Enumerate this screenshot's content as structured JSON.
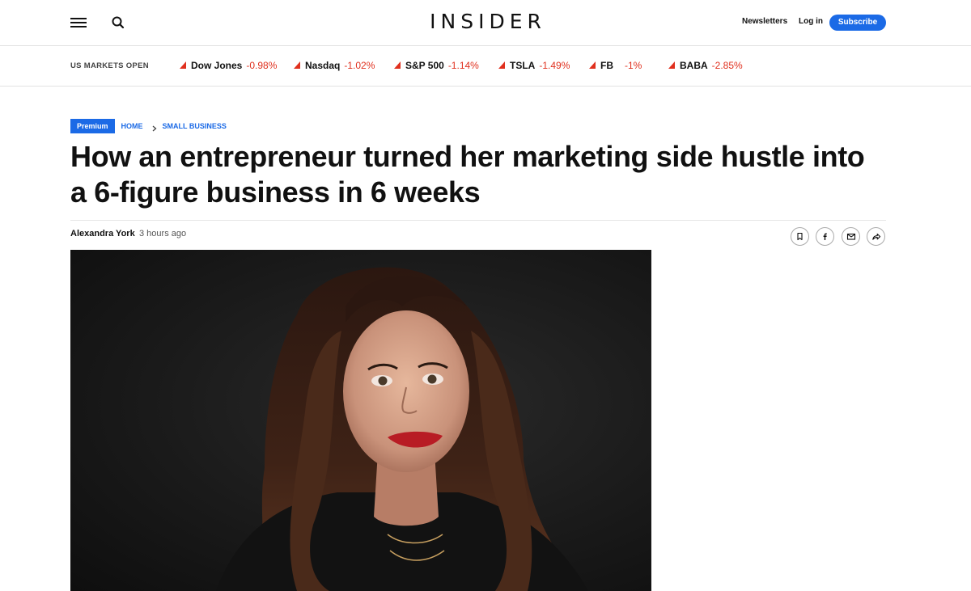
{
  "header": {
    "logo": "INSIDER",
    "newsletters_label": "Newsletters",
    "login_label": "Log in",
    "subscribe_label": "Subscribe",
    "menu_icon": "hamburger-menu-icon",
    "search_icon": "search-icon"
  },
  "markets": {
    "status": "US MARKETS OPEN",
    "tickers": [
      {
        "name": "Dow Jones",
        "change": "-0.98%"
      },
      {
        "name": "Nasdaq",
        "change": "-1.02%"
      },
      {
        "name": "S&P 500",
        "change": "-1.14%"
      },
      {
        "name": "TSLA",
        "change": "-1.49%"
      },
      {
        "name": "FB",
        "change": "-1%"
      },
      {
        "name": "BABA",
        "change": "-2.85%"
      }
    ]
  },
  "article": {
    "badge": "Premium",
    "breadcrumb": [
      "HOME",
      "SMALL BUSINESS"
    ],
    "headline": "How an entrepreneur turned her marketing side hustle into a 6-figure business in 6 weeks",
    "author": "Alexandra York",
    "timestamp": "3 hours ago",
    "share_icons": [
      "bookmark-icon",
      "facebook-icon",
      "email-icon",
      "share-icon"
    ]
  },
  "colors": {
    "accent": "#1b6ae6",
    "negative": "#e0301e",
    "text": "#111111",
    "photo_background": "#1a1a1a"
  }
}
